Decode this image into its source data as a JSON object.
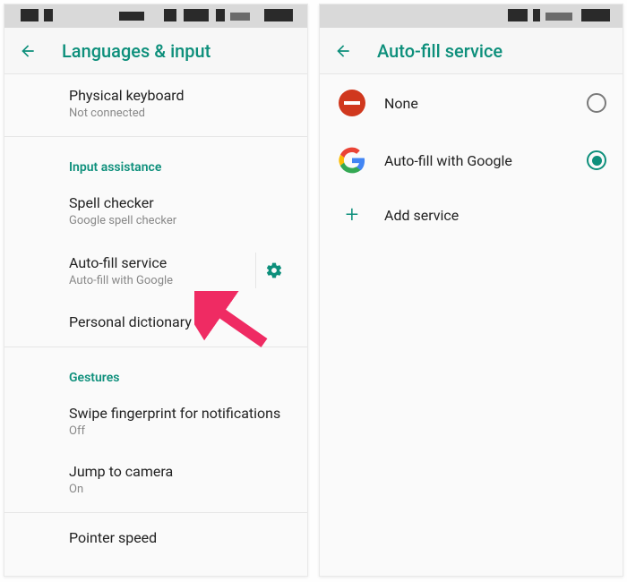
{
  "colors": {
    "accent": "#0d8f7b",
    "danger": "#d0381e"
  },
  "left": {
    "title": "Languages & input",
    "items": {
      "physical_keyboard": {
        "title": "Physical keyboard",
        "subtitle": "Not connected"
      },
      "input_assistance_header": "Input assistance",
      "spell_checker": {
        "title": "Spell checker",
        "subtitle": "Google spell checker"
      },
      "autofill": {
        "title": "Auto-fill service",
        "subtitle": "Auto-fill with Google"
      },
      "personal_dictionary": {
        "title": "Personal dictionary"
      },
      "gestures_header": "Gestures",
      "swipe_fp": {
        "title": "Swipe fingerprint for notifications",
        "subtitle": "Off"
      },
      "jump_camera": {
        "title": "Jump to camera",
        "subtitle": "On"
      },
      "pointer_speed": {
        "title": "Pointer speed"
      }
    }
  },
  "right": {
    "title": "Auto-fill service",
    "options": {
      "none": {
        "label": "None",
        "selected": false
      },
      "google": {
        "label": "Auto-fill with Google",
        "selected": true
      },
      "add": {
        "label": "Add service"
      }
    }
  }
}
